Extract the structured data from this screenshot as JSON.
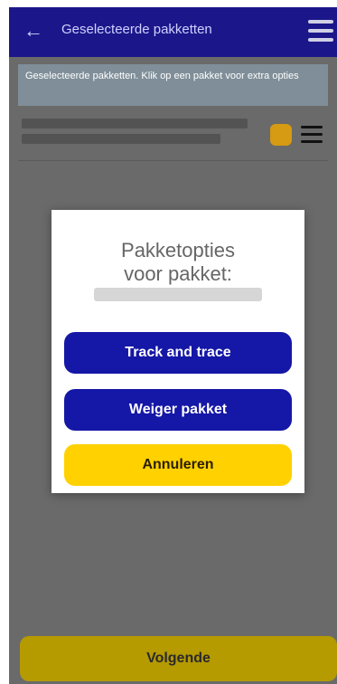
{
  "header": {
    "title": "Geselecteerde pakketten",
    "back_icon": "arrow-left-icon",
    "menu_icon": "hamburger-icon",
    "colors": {
      "bar": "#1b178a",
      "text": "#cfd0ff"
    }
  },
  "screen": {
    "info_text": "Geselecteerde pakketten. Klik op een pakket voor extra opties",
    "package_row": {
      "icon": "package-icon",
      "menu_icon": "hamburger-icon"
    },
    "footer_label": "Volgende"
  },
  "dialog": {
    "title_line1": "Pakketopties",
    "title_line2": "voor pakket:",
    "buttons": [
      {
        "label": "Track and trace"
      },
      {
        "label": "Weiger pakket"
      },
      {
        "label": "Annuleren"
      }
    ],
    "colors": {
      "primary": "#1517a6",
      "secondary": "#ffd100"
    }
  }
}
